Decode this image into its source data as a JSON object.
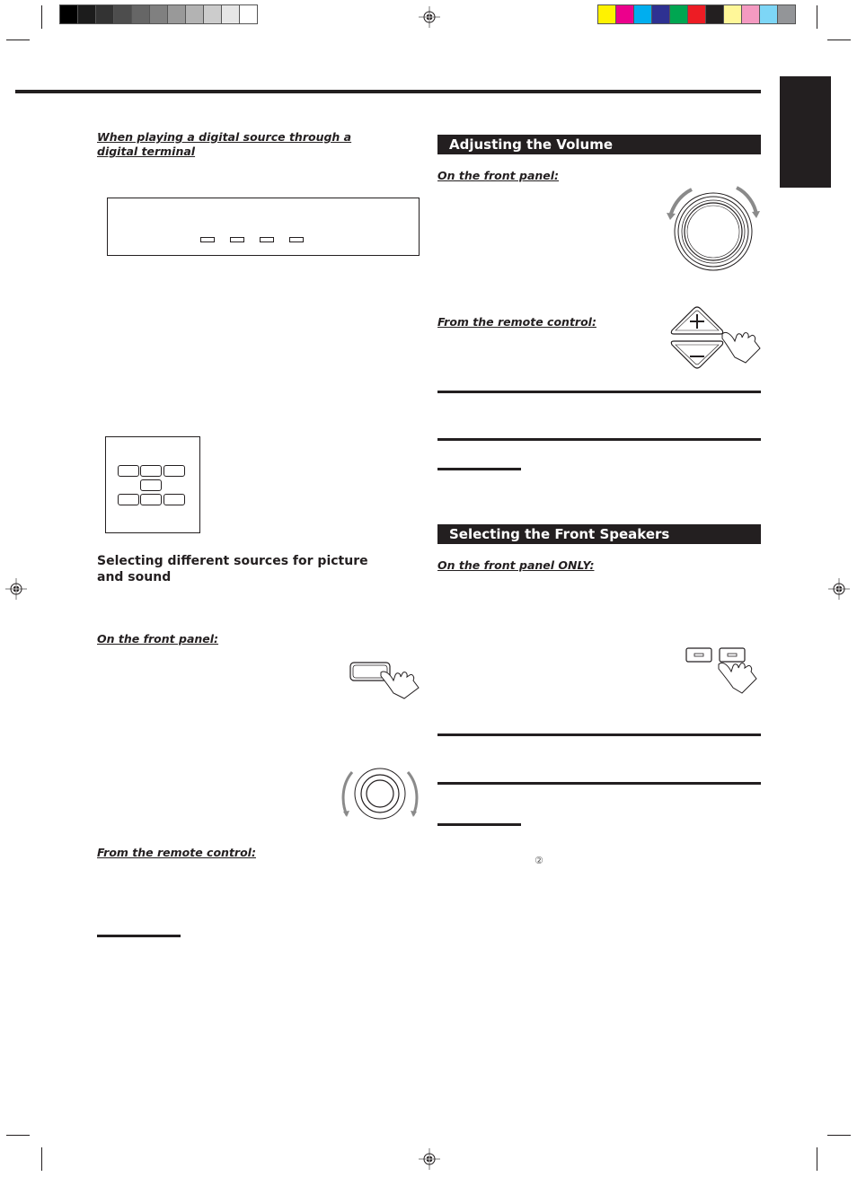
{
  "print_marks": {
    "grayscale_swatches": [
      "#000000",
      "#1c1c1c",
      "#333333",
      "#4d4d4d",
      "#666666",
      "#808080",
      "#999999",
      "#b3b3b3",
      "#cccccc",
      "#e6e6e6",
      "#ffffff"
    ],
    "color_swatches": [
      "#fff200",
      "#ec008c",
      "#00aeef",
      "#2e3192",
      "#00a651",
      "#ed1c24",
      "#231f20",
      "#fff799",
      "#f49ac1",
      "#7dd6f6",
      "#939598"
    ]
  },
  "left_column": {
    "digital_heading": "When playing a digital source through a digital terminal",
    "picture_sound_heading": "Selecting different sources for picture and sound",
    "front_panel_label": "On the front panel:",
    "remote_label": "From the remote control:"
  },
  "right_column": {
    "volume_section": {
      "title": "Adjusting the Volume",
      "front_panel_label": "On the front panel:",
      "remote_label": "From the remote control:",
      "plus_symbol": "+",
      "minus_symbol": "−"
    },
    "speakers_section": {
      "title": "Selecting the Front Speakers",
      "front_panel_label": "On the front panel ONLY:"
    },
    "step_marker": "②"
  },
  "colors": {
    "ink": "#231f20",
    "arrow_gray": "#8a8a8a"
  }
}
